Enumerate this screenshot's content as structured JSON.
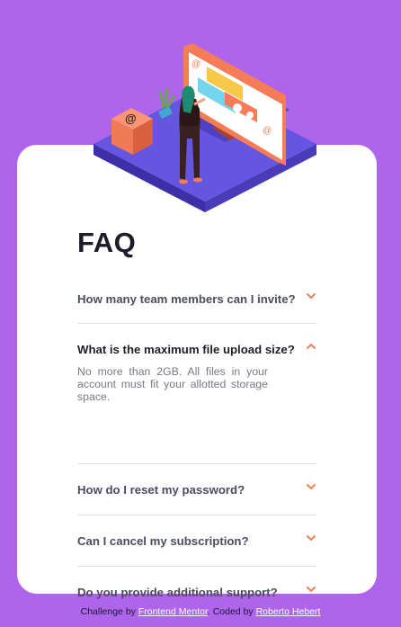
{
  "faq": {
    "title": "FAQ",
    "items": [
      {
        "question": "How many team members can I invite?",
        "open": false
      },
      {
        "question": "What is the maximum file upload size?",
        "open": true,
        "answer": "No more than 2GB. All files in your account must fit your allotted storage space."
      },
      {
        "question": "How do I reset my password?",
        "open": false
      },
      {
        "question": "Can I cancel my subscription?",
        "open": false
      },
      {
        "question": "Do you provide additional support?",
        "open": false
      }
    ]
  },
  "footer": {
    "prefix": "Challenge by",
    "challenge_link": "Frontend Mentor",
    "middle": ". Coded by",
    "author_link": "Roberto Hebert"
  },
  "colors": {
    "background": "#ae65ec",
    "card": "#ffffff",
    "accent": "#f47c57",
    "platform": "#5c4ecf"
  },
  "icons": {
    "chevron_closed": "chevron-down-icon",
    "chevron_open": "chevron-up-icon"
  }
}
